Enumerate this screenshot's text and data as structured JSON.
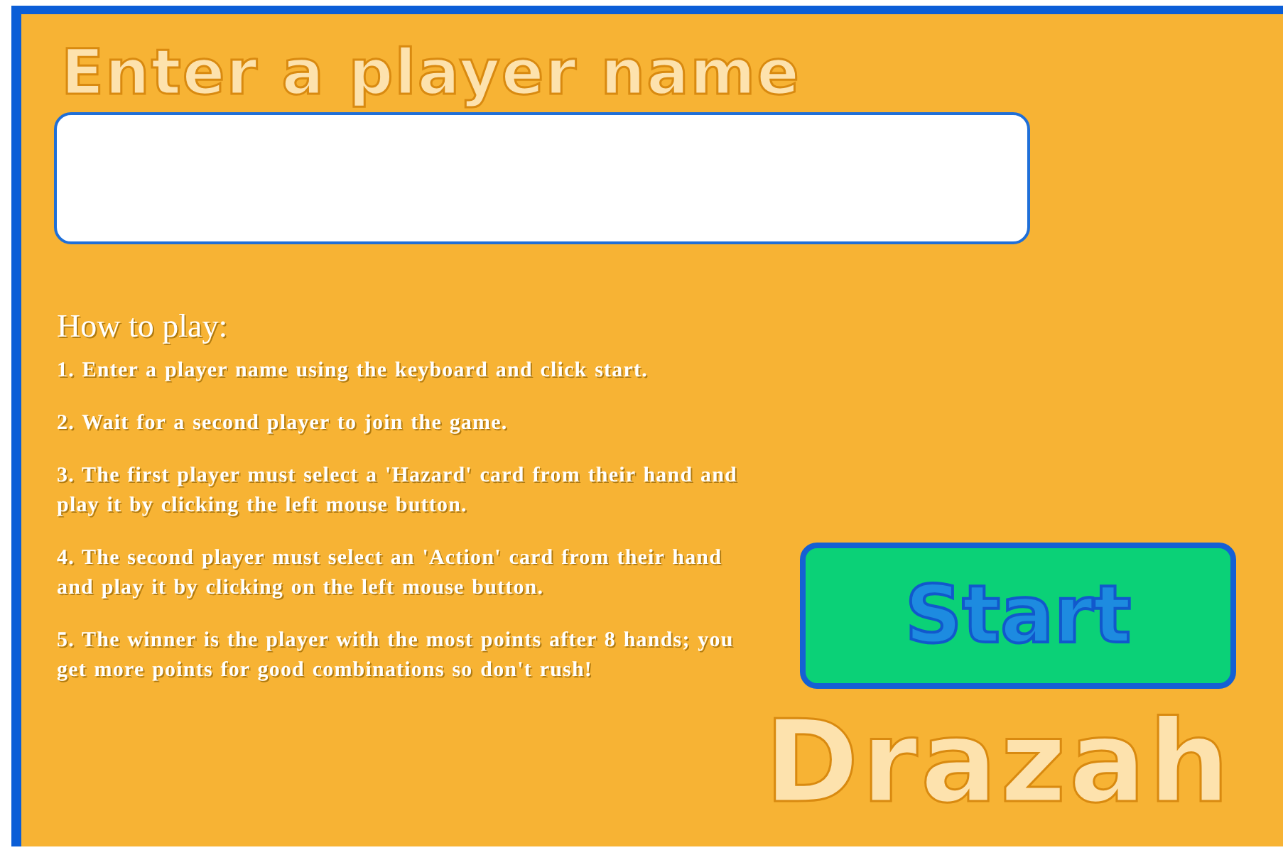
{
  "heading": "Enter a player name",
  "instructions": {
    "title": "How to play:",
    "steps": [
      "1. Enter a player name using the keyboard and click start.",
      "2. Wait for a second player to join the game.",
      "3. The first player must select a 'Hazard' card from their hand and play it by clicking the left mouse button.",
      "4. The second player must select an 'Action' card from their hand and play it by clicking on the left mouse button.",
      "5. The winner is the player with the most points after 8 hands; you get more points for good combinations so don't rush!"
    ]
  },
  "start_button": "Start",
  "logo": "Drazah"
}
